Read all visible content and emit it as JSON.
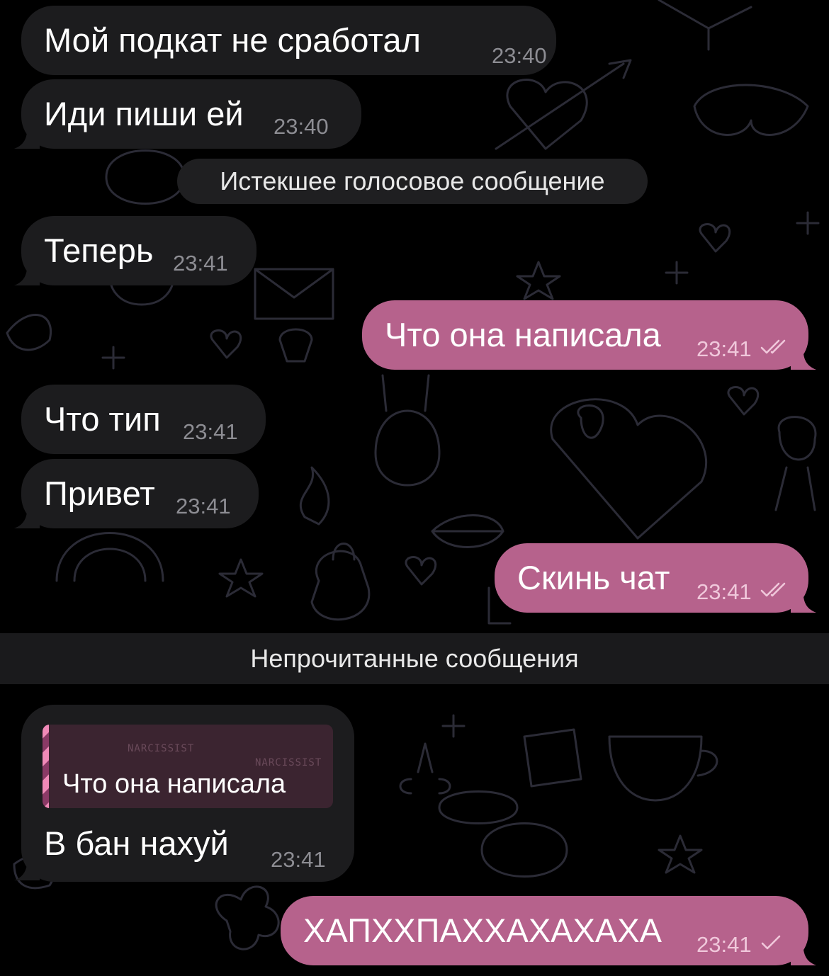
{
  "theme": {
    "incoming_bubble": "#1c1c1e",
    "outgoing_bubble": "#b6628c",
    "background": "#000000",
    "wallpaper_line": "#2a2a34"
  },
  "messages": [
    {
      "direction": "in",
      "text": "Мой подкат не сработал",
      "time": "23:40"
    },
    {
      "direction": "in",
      "text": "Иди пиши ей",
      "time": "23:40"
    },
    {
      "type": "service",
      "text": "Истекшее голосовое сообщение"
    },
    {
      "direction": "in",
      "text": "Теперь",
      "time": "23:41"
    },
    {
      "direction": "out",
      "text": "Что она написала",
      "time": "23:41",
      "status": "read-double-check-icon"
    },
    {
      "direction": "in",
      "text": "Что тип",
      "time": "23:41"
    },
    {
      "direction": "in",
      "text": "Привет",
      "time": "23:41"
    },
    {
      "direction": "out",
      "text": "Скинь чат",
      "time": "23:41",
      "status": "read-double-check-icon"
    },
    {
      "type": "unread-divider",
      "text": "Непрочитанные сообщения"
    },
    {
      "direction": "in",
      "reply_to": "Что она написала",
      "reply_decoration": "NARCISSIST",
      "text": "В бан нахуй",
      "time": "23:41"
    },
    {
      "direction": "out",
      "text": "ХАПХХПАХХАХАХАХА",
      "time": "23:41",
      "status": "sent-single-check-icon"
    }
  ]
}
